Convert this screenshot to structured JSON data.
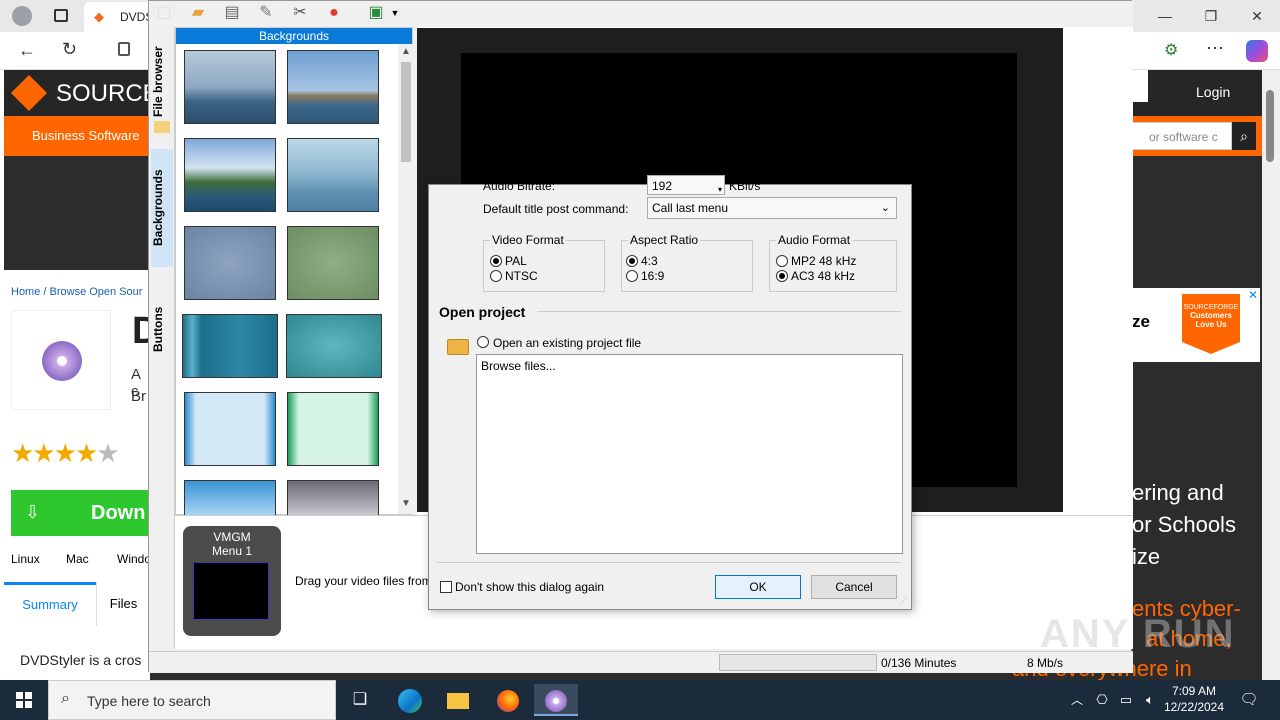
{
  "browser": {
    "tab_title": "DVDS",
    "window_controls": {
      "minimize": "—",
      "restore": "❐",
      "close": "✕"
    }
  },
  "site": {
    "logo": "SOURCE",
    "business_link": "Business Software",
    "login": "Login",
    "search_placeholder": "or software c",
    "breadcrumb": "Home / Browse Open Sour",
    "title_initial": "D",
    "desc_1": "A c",
    "desc_2": "Br",
    "download_label": "Down",
    "platforms": [
      "Linux",
      "Mac",
      "Windo"
    ],
    "tabs": [
      "Summary",
      "Files"
    ],
    "summary_text": "DVDStyler is a cros",
    "ad_text": "ze",
    "ad_badge": "Customers Love Us",
    "ad_brand": "SOURCEFORGE",
    "right_text_1": "ering and",
    "right_text_2": "or Schools",
    "right_text_3": "ize",
    "right_orange_1": "ents cyber-",
    "right_orange_2": "at home,",
    "right_orange_3": "and everywhere in"
  },
  "app": {
    "vtabs": [
      "File browser",
      "Backgrounds",
      "Buttons"
    ],
    "panel_title": "Backgrounds",
    "menu_tile_title": "VMGM",
    "menu_tile_sub": "Menu 1",
    "drag_hint": "Drag your video files from",
    "status_minutes": "0/136 Minutes",
    "status_rate": "8 Mb/s"
  },
  "dialog": {
    "audio_bitrate_label": "Audio Bitrate:",
    "audio_bitrate_value": "192",
    "audio_bitrate_unit": "KBit/s",
    "post_command_label": "Default title post command:",
    "post_command_value": "Call last menu",
    "video_format_title": "Video Format",
    "video_pal": "PAL",
    "video_ntsc": "NTSC",
    "aspect_title": "Aspect Ratio",
    "aspect_43": "4:3",
    "aspect_169": "16:9",
    "audio_format_title": "Audio Format",
    "audio_mp2": "MP2 48 kHz",
    "audio_ac3": "AC3 48 kHz",
    "open_project_title": "Open project",
    "open_existing_label": "Open an existing project file",
    "browse_files": "Browse files...",
    "dont_show": "Don't show this dialog again",
    "ok": "OK",
    "cancel": "Cancel"
  },
  "taskbar": {
    "search_placeholder": "Type here to search",
    "time": "7:09 AM",
    "date": "12/22/2024"
  },
  "watermark": "ANY RUN"
}
